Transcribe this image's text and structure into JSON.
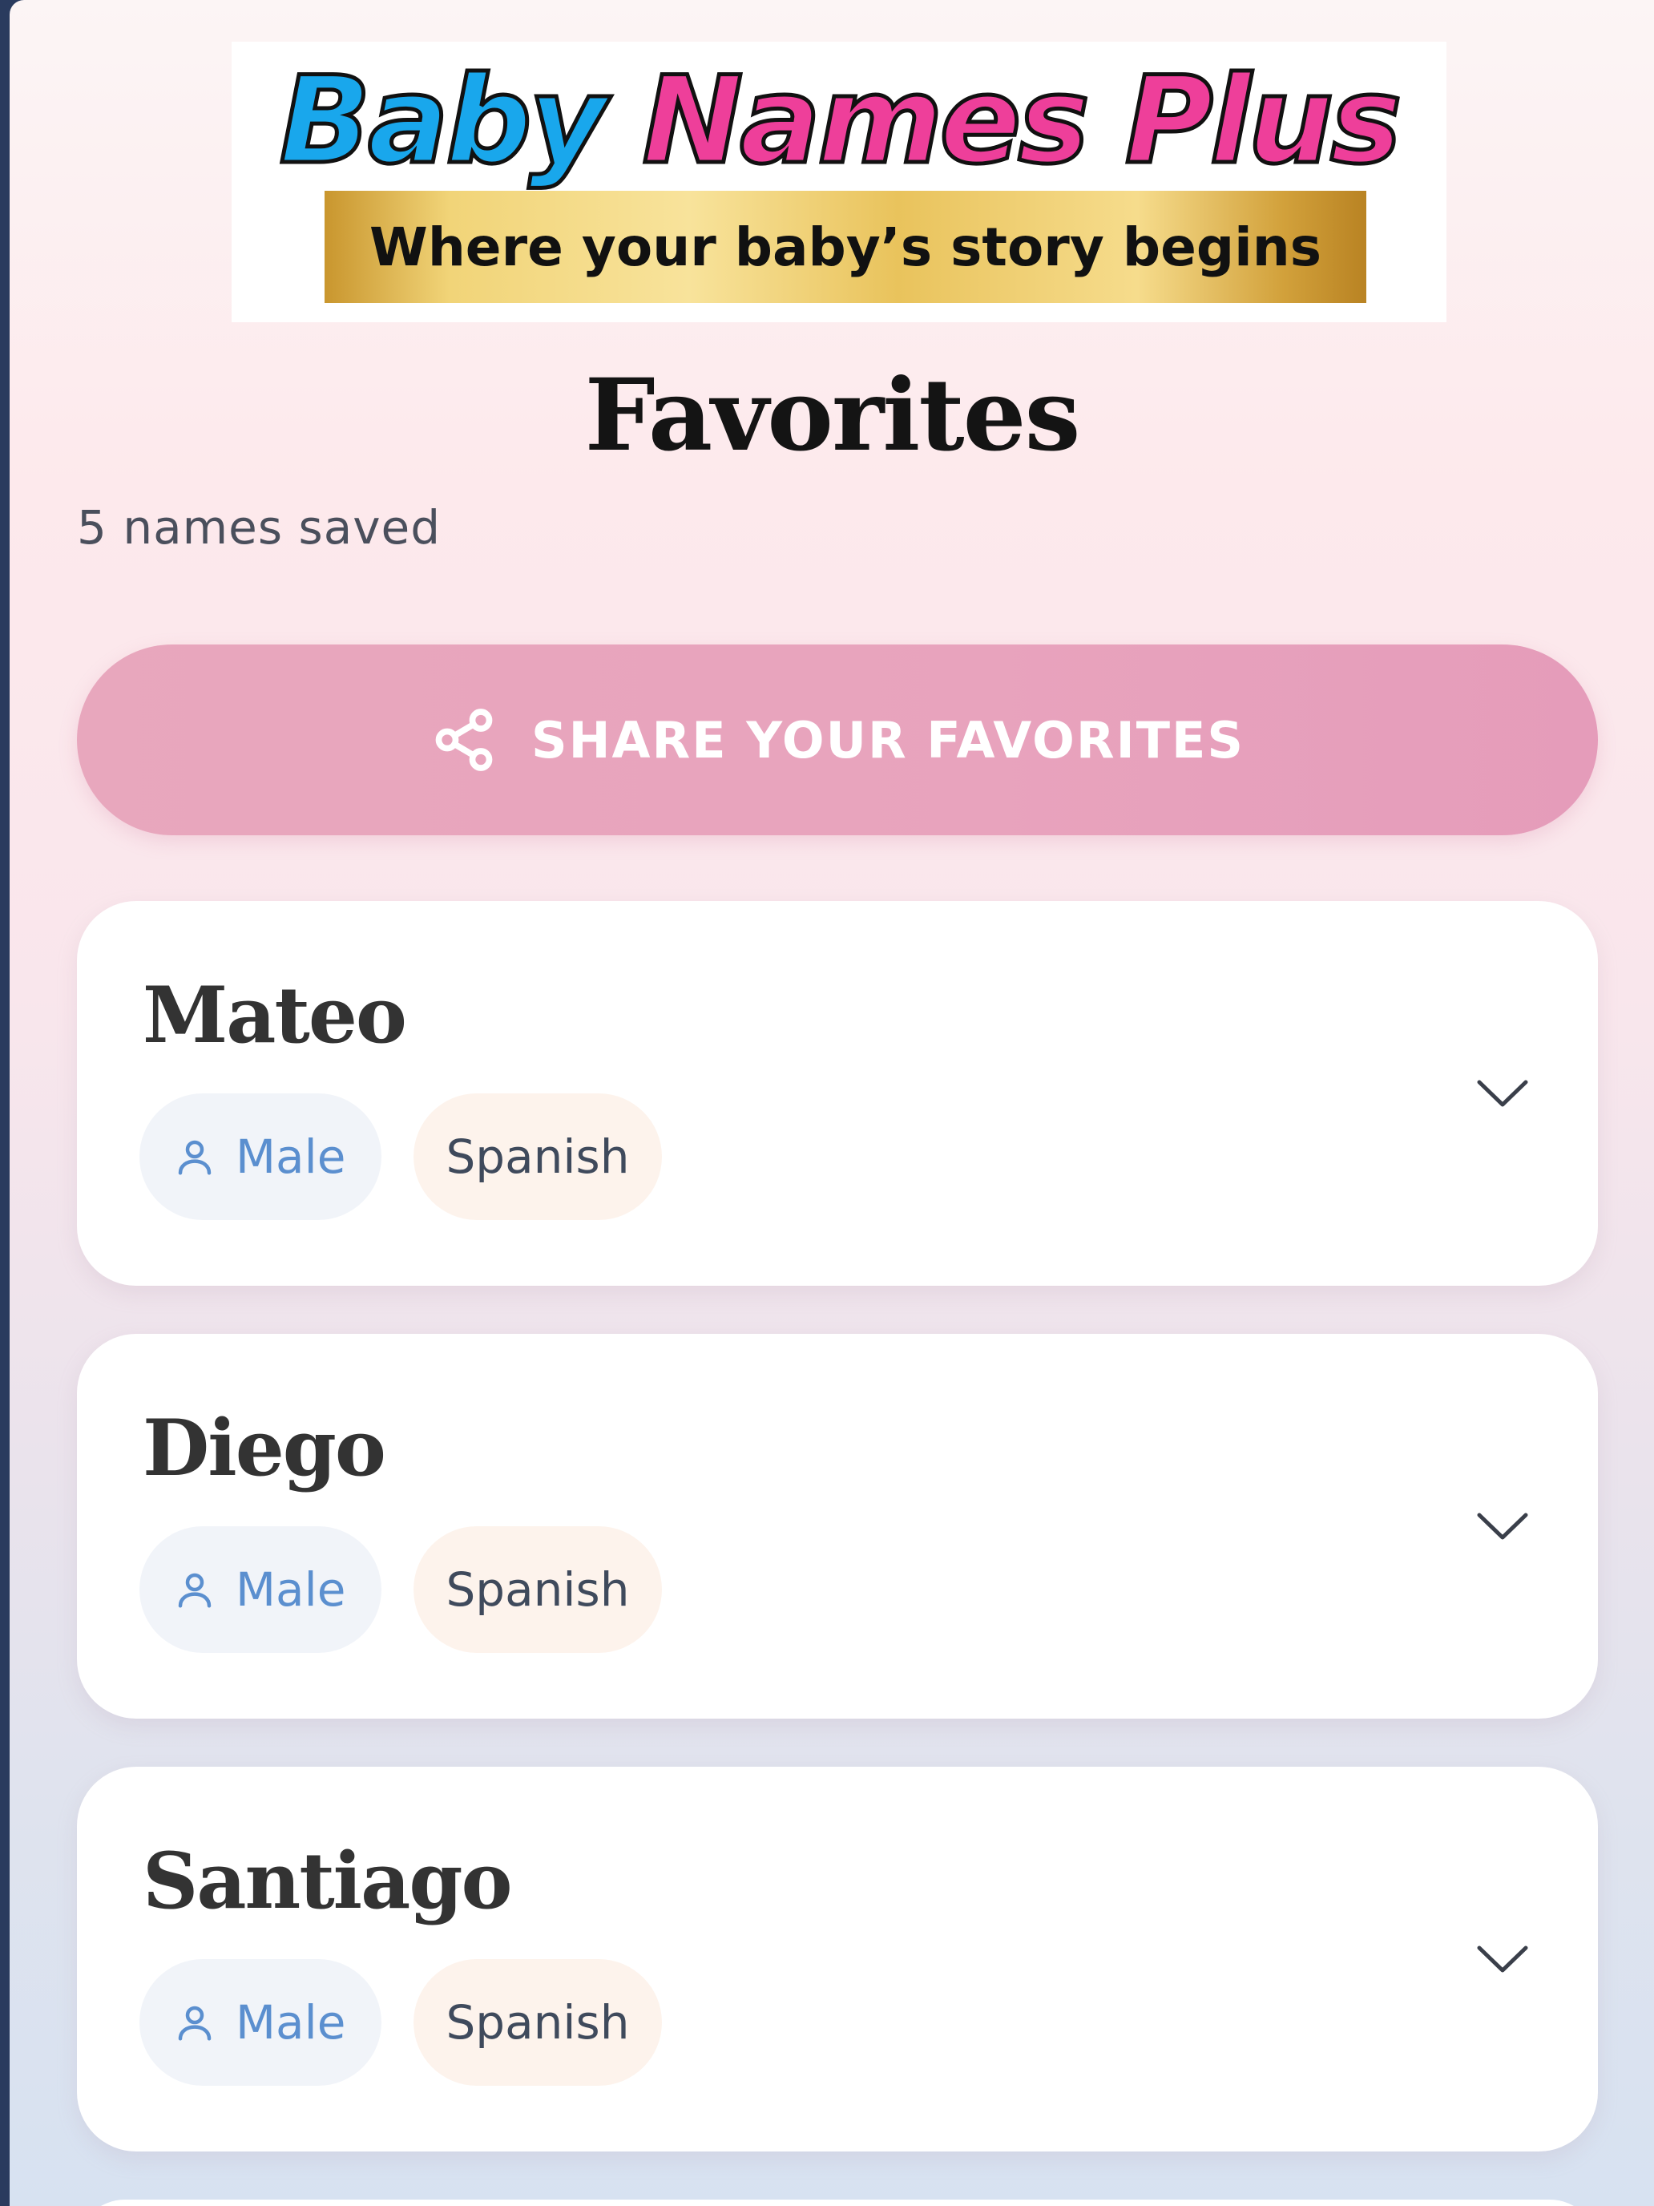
{
  "brand": {
    "logo_word1": "Baby",
    "logo_word2": "Names Plus",
    "tagline": "Where your baby’s story begins"
  },
  "page": {
    "title": "Favorites",
    "count_text": "5 names saved"
  },
  "share": {
    "label": "SHARE YOUR FAVORITES",
    "icon": "share-icon"
  },
  "favorites": [
    {
      "name": "Mateo",
      "gender": "Male",
      "origin": "Spanish"
    },
    {
      "name": "Diego",
      "gender": "Male",
      "origin": "Spanish"
    },
    {
      "name": "Santiago",
      "gender": "Male",
      "origin": "Spanish"
    }
  ],
  "colors": {
    "accent_pink": "#e8a3bd",
    "logo_blue": "#19a7ec",
    "logo_pink": "#ee3f9a",
    "gender_text": "#5b8fcf"
  }
}
